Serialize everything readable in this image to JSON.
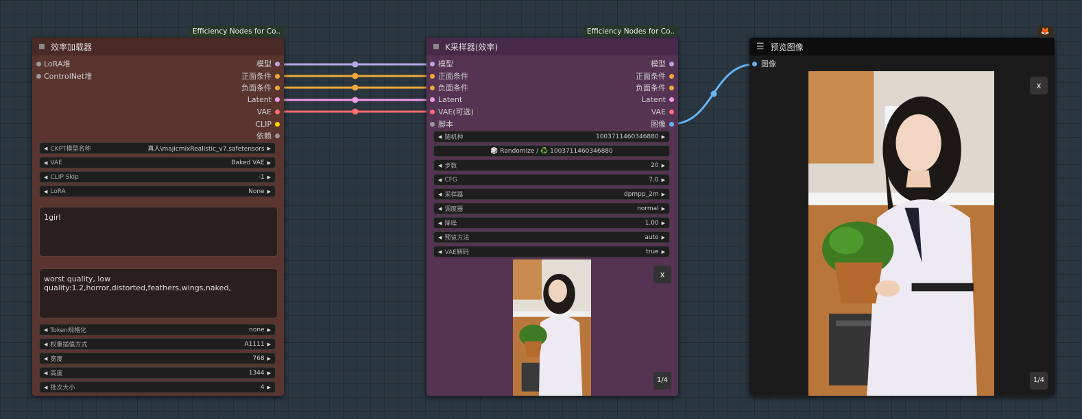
{
  "colors": {
    "model": "#b8a8e6",
    "conditioning": "#f2a83a",
    "latent": "#f29ce6",
    "vae": "#ff6e6e",
    "clip": "#ffd500",
    "image": "#64b5f6",
    "gray": "#9a9a9a"
  },
  "loader": {
    "badge": "Efficiency Nodes for Co..",
    "title": "效率加载器",
    "inputs": [
      "LoRA堆",
      "ControlNet堆"
    ],
    "outputs": [
      "模型",
      "正面条件",
      "负面条件",
      "Latent",
      "VAE",
      "CLIP",
      "依赖"
    ],
    "widgets": [
      {
        "label": "CKPT模型名称",
        "value": "真人\\majicmixRealistic_v7.safetensors"
      },
      {
        "label": "VAE",
        "value": "Baked VAE"
      },
      {
        "label": "CLIP Skip",
        "value": "-1"
      },
      {
        "label": "LoRA",
        "value": "None"
      }
    ],
    "positive_prompt": "1girl",
    "negative_prompt": "worst quality, low quality:1.2,horror,distorted,feathers,wings,naked,",
    "widgets2": [
      {
        "label": "Token规格化",
        "value": "none"
      },
      {
        "label": "权重插值方式",
        "value": "A1111"
      },
      {
        "label": "宽度",
        "value": "768"
      },
      {
        "label": "高度",
        "value": "1344"
      },
      {
        "label": "批次大小",
        "value": "4"
      }
    ]
  },
  "sampler": {
    "badge": "Efficiency Nodes for Co..",
    "title": "K采样器(效率)",
    "inputs": [
      "模型",
      "正面条件",
      "负面条件",
      "Latent",
      "VAE(可选)",
      "脚本"
    ],
    "outputs": [
      "模型",
      "正面条件",
      "负面条件",
      "Latent",
      "VAE",
      "图像"
    ],
    "seed": {
      "label": "随机种",
      "value": "1003711460346880"
    },
    "randomize": "🎲 Randomize / ♻️ 1003711460346880",
    "widgets": [
      {
        "label": "步数",
        "value": "20"
      },
      {
        "label": "CFG",
        "value": "7.0"
      },
      {
        "label": "采样器",
        "value": "dpmpp_2m"
      },
      {
        "label": "调度器",
        "value": "normal"
      },
      {
        "label": "降噪",
        "value": "1.00"
      },
      {
        "label": "预览方法",
        "value": "auto"
      },
      {
        "label": "VAE解码",
        "value": "true"
      }
    ],
    "close": "x",
    "pager": "1/4"
  },
  "preview": {
    "badge": "🦊",
    "title": "预览图像",
    "input": "图像",
    "close": "x",
    "pager": "1/4"
  }
}
